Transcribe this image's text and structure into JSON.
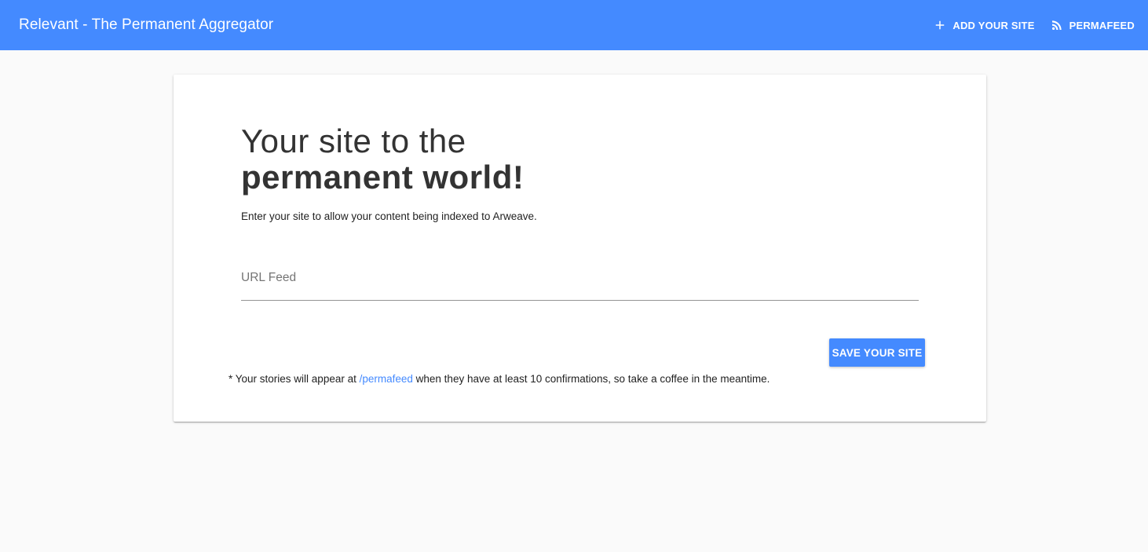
{
  "appbar": {
    "title": "Relevant - The Permanent Aggregator",
    "background_color": "#448aff",
    "nav": [
      {
        "label": "ADD YOUR SITE",
        "icon": "plus-icon"
      },
      {
        "label": "PERMAFEED",
        "icon": "rss-icon"
      }
    ]
  },
  "card": {
    "heading_line1": "Your site to the",
    "heading_line2": "permanent world!",
    "subtitle": "Enter your site to allow your content being indexed to Arweave.",
    "url_field": {
      "placeholder": "URL Feed",
      "value": ""
    },
    "save_button_label": "SAVE YOUR SITE",
    "footnote": {
      "prefix": "* Your stories will appear at ",
      "link_text": "/permafeed",
      "suffix": " when they have at least 10 confirmations, so take a coffee in the meantime."
    }
  },
  "colors": {
    "accent": "#448aff",
    "page_background": "#fafafa",
    "card_background": "#ffffff",
    "text": "#333333"
  }
}
